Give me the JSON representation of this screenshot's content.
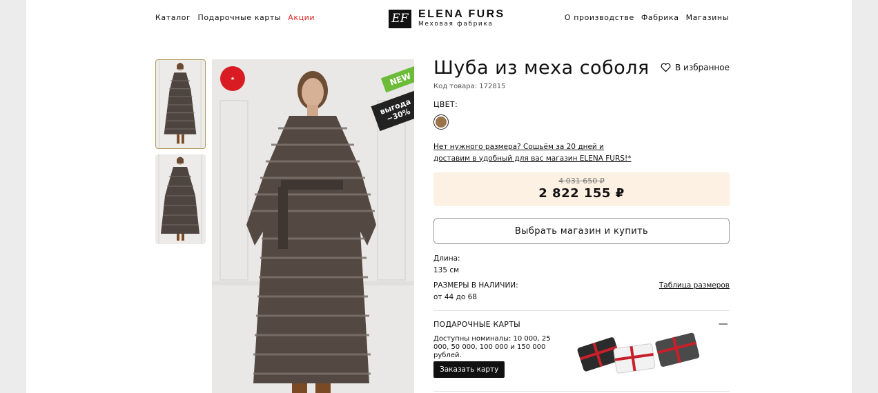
{
  "header": {
    "nav_left": [
      "Каталог",
      "Подарочные карты",
      "Акции"
    ],
    "nav_right": [
      "О производстве",
      "Фабрика",
      "Магазины"
    ],
    "logo_title": "ELENA FURS",
    "logo_subtitle": "Меховая фабрика",
    "logo_mark": "EF",
    "sale_color": "#dd2222"
  },
  "badges": {
    "new": "NEW",
    "sale_line1": "выгода",
    "sale_line2": "−30%"
  },
  "product": {
    "title": "Шуба из меха соболя",
    "favorite_label": "В избранное",
    "sku": "Код товара: 172815",
    "color_label": "ЦВЕТ:",
    "color_swatch": "#9a7348",
    "size_note": "Нет нужного размера? Сошьём за 20 дней и доставим в удобный для вас магазин ELENA FURS!*",
    "old_price": "4 031 650 ₽",
    "new_price": "2 822 155 ₽",
    "buy_button": "Выбрать магазин и купить",
    "length_label": "Длина:",
    "length_value": "135 см",
    "sizes_label": "РАЗМЕРЫ В НАЛИЧИИ:",
    "sizes_value": "от 44 до 68",
    "size_table_link": "Таблица размеров"
  },
  "gift_cards": {
    "heading": "ПОДАРОЧНЫЕ КАРТЫ",
    "text": "Доступны номиналы: 10 000, 25 000, 50 000, 100 000 и 150 000 рублей.",
    "button": "Заказать карту"
  }
}
